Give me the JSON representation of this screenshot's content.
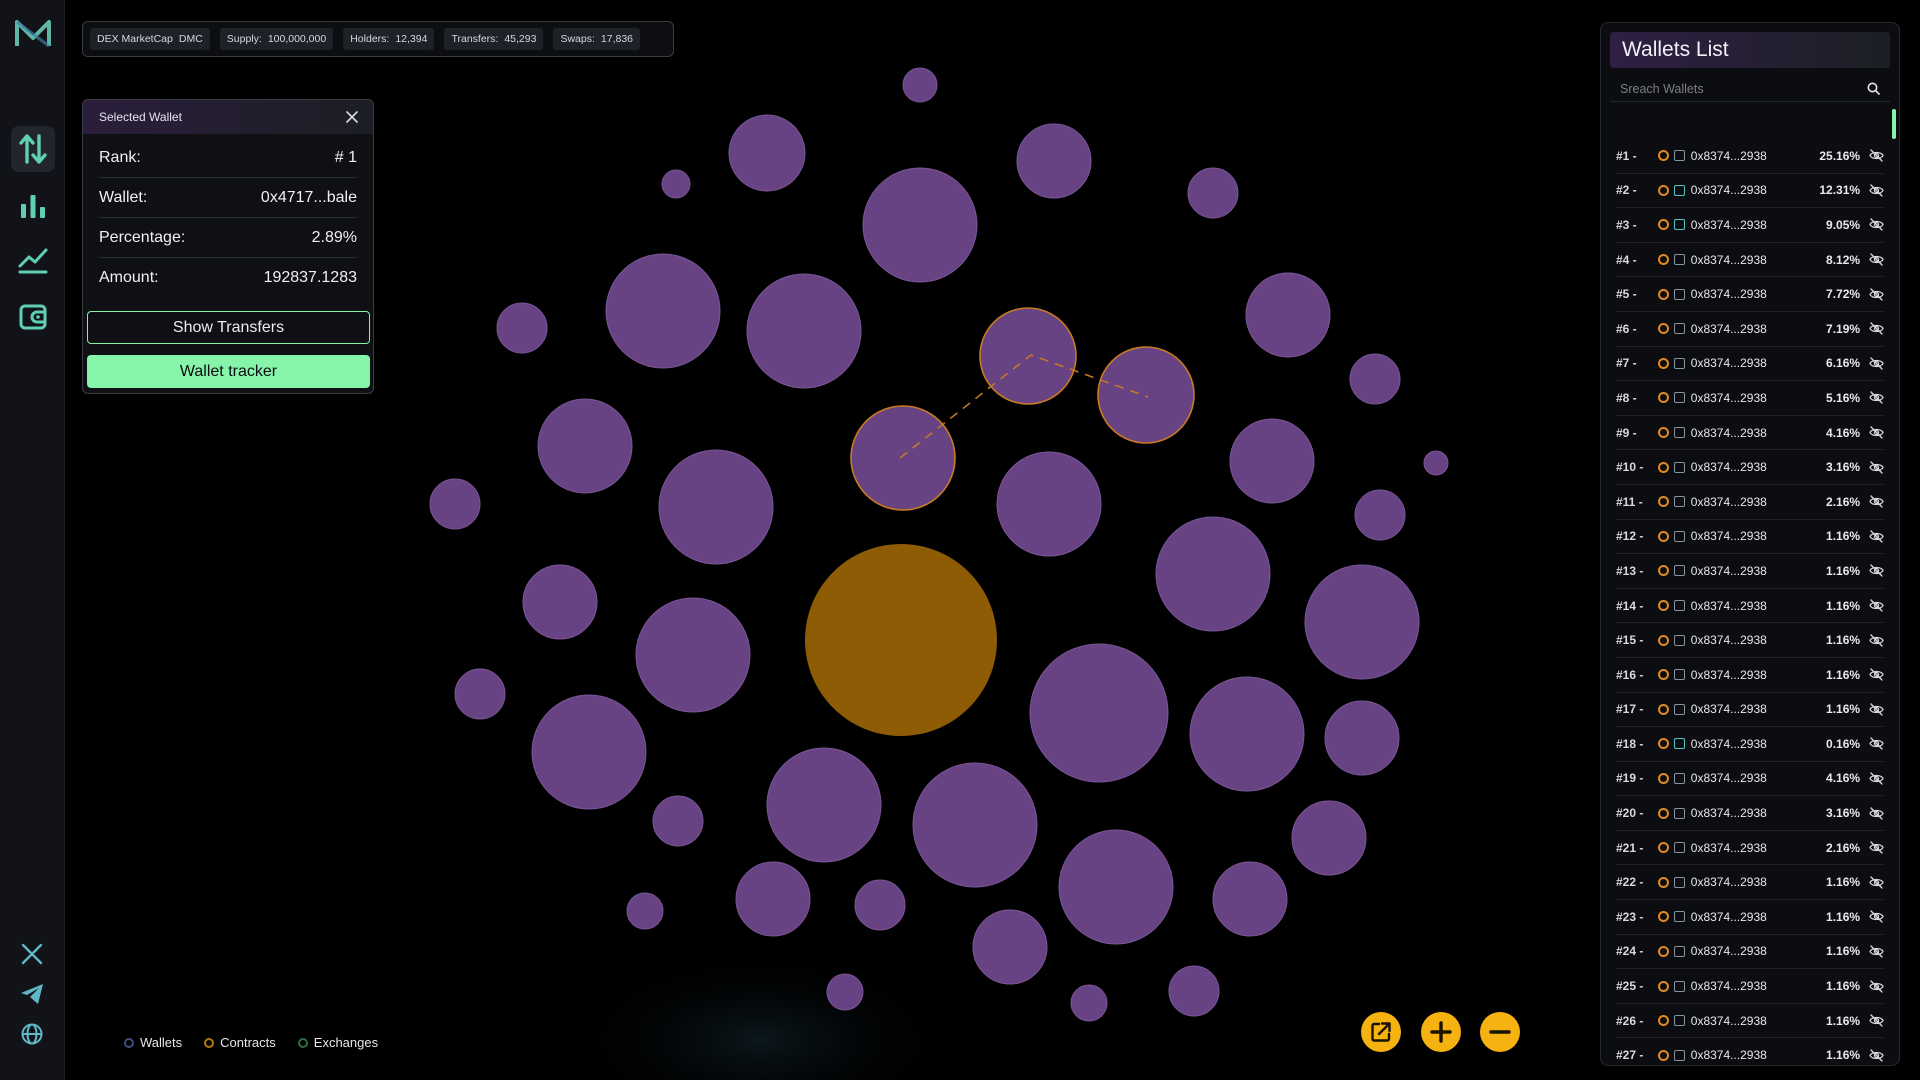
{
  "colors": {
    "accent_green": "#86f5a9",
    "wallet_bubble": "#674383",
    "contract_bubble": "#8e5c04",
    "highlight_ring": "#c97a23",
    "control_yellow": "#f5b211"
  },
  "rail": {
    "logo": "m-logo-icon",
    "nav": [
      {
        "icon": "transfers-arrows-icon",
        "active": true
      },
      {
        "icon": "bar-chart-icon",
        "active": false
      },
      {
        "icon": "line-chart-icon",
        "active": false
      },
      {
        "icon": "wallet-icon",
        "active": false
      }
    ],
    "social": [
      "x-twitter-icon",
      "telegram-icon",
      "globe-icon"
    ]
  },
  "stats": {
    "token_label": "DEX MarketCap",
    "token_symbol": "DMC",
    "supply_label": "Supply:",
    "supply_value": "100,000,000",
    "holders_label": "Holders:",
    "holders_value": "12,394",
    "transfers_label": "Transfers:",
    "transfers_value": "45,293",
    "swaps_label": "Swaps:",
    "swaps_value": "17,836"
  },
  "selected_wallet": {
    "title": "Selected Wallet",
    "rows": [
      {
        "label": "Rank:",
        "value": "# 1"
      },
      {
        "label": "Wallet:",
        "value": "0x4717...bale"
      },
      {
        "label": "Percentage:",
        "value": "2.89%"
      },
      {
        "label": "Amount:",
        "value": "192837.1283"
      }
    ],
    "show_transfers_label": "Show Transfers",
    "wallet_tracker_label": "Wallet tracker"
  },
  "legend": [
    {
      "label": "Wallets",
      "color": "#3e4f7d"
    },
    {
      "label": "Contracts",
      "color": "#b5780f"
    },
    {
      "label": "Exchanges",
      "color": "#2f6e42"
    }
  ],
  "controls": [
    "external-link-icon",
    "zoom-in-icon",
    "zoom-out-icon"
  ],
  "wallets_list": {
    "title": "Wallets List",
    "search_placeholder": "Sreach Wallets",
    "rows": [
      {
        "rank": "#1 -",
        "address": "0x8374...2938",
        "pct": "25.16%",
        "exchange": false
      },
      {
        "rank": "#2 -",
        "address": "0x8374...2938",
        "pct": "12.31%",
        "exchange": true
      },
      {
        "rank": "#3 -",
        "address": "0x8374...2938",
        "pct": "9.05%",
        "exchange": true
      },
      {
        "rank": "#4 -",
        "address": "0x8374...2938",
        "pct": "8.12%",
        "exchange": false
      },
      {
        "rank": "#5 -",
        "address": "0x8374...2938",
        "pct": "7.72%",
        "exchange": false
      },
      {
        "rank": "#6 -",
        "address": "0x8374...2938",
        "pct": "7.19%",
        "exchange": false
      },
      {
        "rank": "#7 -",
        "address": "0x8374...2938",
        "pct": "6.16%",
        "exchange": false
      },
      {
        "rank": "#8 -",
        "address": "0x8374...2938",
        "pct": "5.16%",
        "exchange": false
      },
      {
        "rank": "#9 -",
        "address": "0x8374...2938",
        "pct": "4.16%",
        "exchange": false
      },
      {
        "rank": "#10 -",
        "address": "0x8374...2938",
        "pct": "3.16%",
        "exchange": false
      },
      {
        "rank": "#11 -",
        "address": "0x8374...2938",
        "pct": "2.16%",
        "exchange": false
      },
      {
        "rank": "#12 -",
        "address": "0x8374...2938",
        "pct": "1.16%",
        "exchange": false
      },
      {
        "rank": "#13 -",
        "address": "0x8374...2938",
        "pct": "1.16%",
        "exchange": false
      },
      {
        "rank": "#14 -",
        "address": "0x8374...2938",
        "pct": "1.16%",
        "exchange": false
      },
      {
        "rank": "#15 -",
        "address": "0x8374...2938",
        "pct": "1.16%",
        "exchange": false
      },
      {
        "rank": "#16 -",
        "address": "0x8374...2938",
        "pct": "1.16%",
        "exchange": false
      },
      {
        "rank": "#17 -",
        "address": "0x8374...2938",
        "pct": "1.16%",
        "exchange": false
      },
      {
        "rank": "#18 -",
        "address": "0x8374...2938",
        "pct": "0.16%",
        "exchange": true
      },
      {
        "rank": "#19 -",
        "address": "0x8374...2938",
        "pct": "4.16%",
        "exchange": false
      },
      {
        "rank": "#20 -",
        "address": "0x8374...2938",
        "pct": "3.16%",
        "exchange": false
      },
      {
        "rank": "#21 -",
        "address": "0x8374...2938",
        "pct": "2.16%",
        "exchange": false
      },
      {
        "rank": "#22 -",
        "address": "0x8374...2938",
        "pct": "1.16%",
        "exchange": false
      },
      {
        "rank": "#23 -",
        "address": "0x8374...2938",
        "pct": "1.16%",
        "exchange": false
      },
      {
        "rank": "#24 -",
        "address": "0x8374...2938",
        "pct": "1.16%",
        "exchange": false
      },
      {
        "rank": "#25 -",
        "address": "0x8374...2938",
        "pct": "1.16%",
        "exchange": false
      },
      {
        "rank": "#26 -",
        "address": "0x8374...2938",
        "pct": "1.16%",
        "exchange": false
      },
      {
        "rank": "#27 -",
        "address": "0x8374...2938",
        "pct": "1.16%",
        "exchange": false
      }
    ]
  }
}
